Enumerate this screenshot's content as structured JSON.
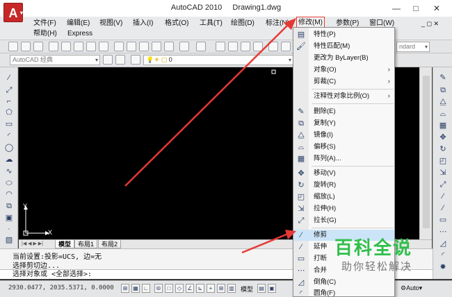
{
  "titlebar": {
    "app_name": "AutoCAD 2010",
    "doc_name": "Drawing1.dwg",
    "logo": "A",
    "controls": {
      "minimize": "—",
      "maximize": "□",
      "close": "✕"
    }
  },
  "menubar": {
    "items": [
      {
        "label": "文件(F)"
      },
      {
        "label": "编辑(E)"
      },
      {
        "label": "视图(V)"
      },
      {
        "label": "插入(I)"
      },
      {
        "label": "格式(O)"
      },
      {
        "label": "工具(T)"
      },
      {
        "label": "绘图(D)"
      },
      {
        "label": "标注(N)"
      },
      {
        "label": "修改(M)"
      },
      {
        "label": "参数(P)"
      },
      {
        "label": "窗口(W)"
      }
    ],
    "row2": [
      {
        "label": "帮助(H)"
      },
      {
        "label": "Express"
      }
    ],
    "doc_controls": "_ ◻ ✕"
  },
  "toolbar": {
    "style_combo": "ndard",
    "workspace_combo": "AutoCAD 经典",
    "layer_combo": "0"
  },
  "dropdown": {
    "items": [
      {
        "label": "特性(P)",
        "icon": "properties-icon",
        "glyph": "▤"
      },
      {
        "label": "特性匹配(M)",
        "icon": "match-properties-icon",
        "glyph": "🖌"
      },
      {
        "label": "更改为 ByLayer(B)",
        "icon": "",
        "glyph": ""
      },
      {
        "label": "对象(O)",
        "icon": "",
        "glyph": "",
        "submenu": "›"
      },
      {
        "label": "剪裁(C)",
        "icon": "",
        "glyph": "",
        "submenu": "›"
      },
      {
        "label": "注释性对象比例(O)",
        "icon": "",
        "glyph": "",
        "submenu": "›"
      },
      {
        "label": "删除(E)",
        "icon": "erase-icon",
        "glyph": "✎"
      },
      {
        "label": "复制(Y)",
        "icon": "copy-icon",
        "glyph": "⧉"
      },
      {
        "label": "镜像(I)",
        "icon": "mirror-icon",
        "glyph": "⧋"
      },
      {
        "label": "偏移(S)",
        "icon": "offset-icon",
        "glyph": "⌓"
      },
      {
        "label": "阵列(A)...",
        "icon": "array-icon",
        "glyph": "▦"
      },
      {
        "label": "移动(V)",
        "icon": "move-icon",
        "glyph": "✥"
      },
      {
        "label": "旋转(R)",
        "icon": "rotate-icon",
        "glyph": "↻"
      },
      {
        "label": "缩放(L)",
        "icon": "scale-icon",
        "glyph": "◰"
      },
      {
        "label": "拉伸(H)",
        "icon": "stretch-icon",
        "glyph": "⇲"
      },
      {
        "label": "拉长(G)",
        "icon": "lengthen-icon",
        "glyph": "⤢"
      },
      {
        "label": "修剪",
        "icon": "trim-icon",
        "glyph": "⁄"
      },
      {
        "label": "延伸",
        "icon": "extend-icon",
        "glyph": "⁄"
      },
      {
        "label": "打断",
        "icon": "break-icon",
        "glyph": "▭"
      },
      {
        "label": "合并",
        "icon": "join-icon",
        "glyph": "⋯"
      },
      {
        "label": "倒角(C)",
        "icon": "chamfer-icon",
        "glyph": "◿"
      },
      {
        "label": "圆角(F)",
        "icon": "fillet-icon",
        "glyph": "◜"
      }
    ]
  },
  "layout_tabs": {
    "nav": "|◀ ◀ ▶ ▶|",
    "tabs": [
      {
        "label": "模型"
      },
      {
        "label": "布局1"
      },
      {
        "label": "布局2"
      }
    ]
  },
  "axis": {
    "x_label": "X",
    "y_label": "Y"
  },
  "command": {
    "history": [
      "当前设置:投影=UCS, 边=无",
      "选择剪切边..."
    ],
    "prompt": "选择对象或 <全部选择>:"
  },
  "status": {
    "coordinates": "2930.0477, 2035.5371, 0.0000",
    "model_label": "模型",
    "auto_label": "Auto"
  },
  "watermark": {
    "title": "百科全说",
    "subtitle": "助你轻松解决"
  },
  "colors": {
    "accent_red": "#e53935",
    "canvas": "#000000",
    "watermark_green": "#2fbf4a"
  }
}
